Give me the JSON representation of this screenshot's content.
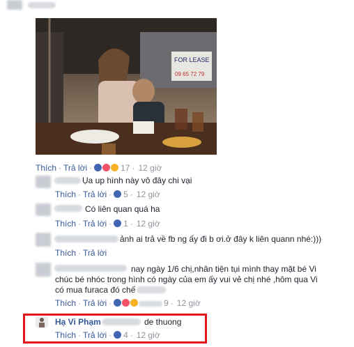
{
  "post_header": {
    "author_blurred": ""
  },
  "photo": {
    "sign_text": "FOR LEASE",
    "sign_number": "09 65 72 79"
  },
  "actions": {
    "like": "Thích",
    "reply": "Trả lời",
    "separator": "·"
  },
  "main_meta": {
    "count": "17",
    "time": "12 giờ"
  },
  "comments": [
    {
      "text": "Ụa up hình này vô đây chi vại",
      "count": "5",
      "time": "12 giờ"
    },
    {
      "text": "Có liên quan quá ha",
      "count": "1",
      "time": "12 giờ"
    },
    {
      "text": "ảnh ai trả về fb ng ấy đi b ơi.ở đây k liên quann nhé:)))",
      "count": "",
      "time": ""
    },
    {
      "line1": "nay ngày 1/6 chị,nhân tiện tụi mình thay mặt bé Vi",
      "line2": "chúc bé nhóc trong hình có ngày của em ấy vui vẻ chị nhé ,hôm qua Vi",
      "line3": "có mua furaca đó chế",
      "count": "9",
      "time": "12 giờ"
    },
    {
      "name": "Hạ Vi Phạm",
      "text": "de thuong",
      "count": "4",
      "time": "12 giờ"
    }
  ],
  "colors": {
    "link": "#365899",
    "highlight": "#e3151a"
  }
}
